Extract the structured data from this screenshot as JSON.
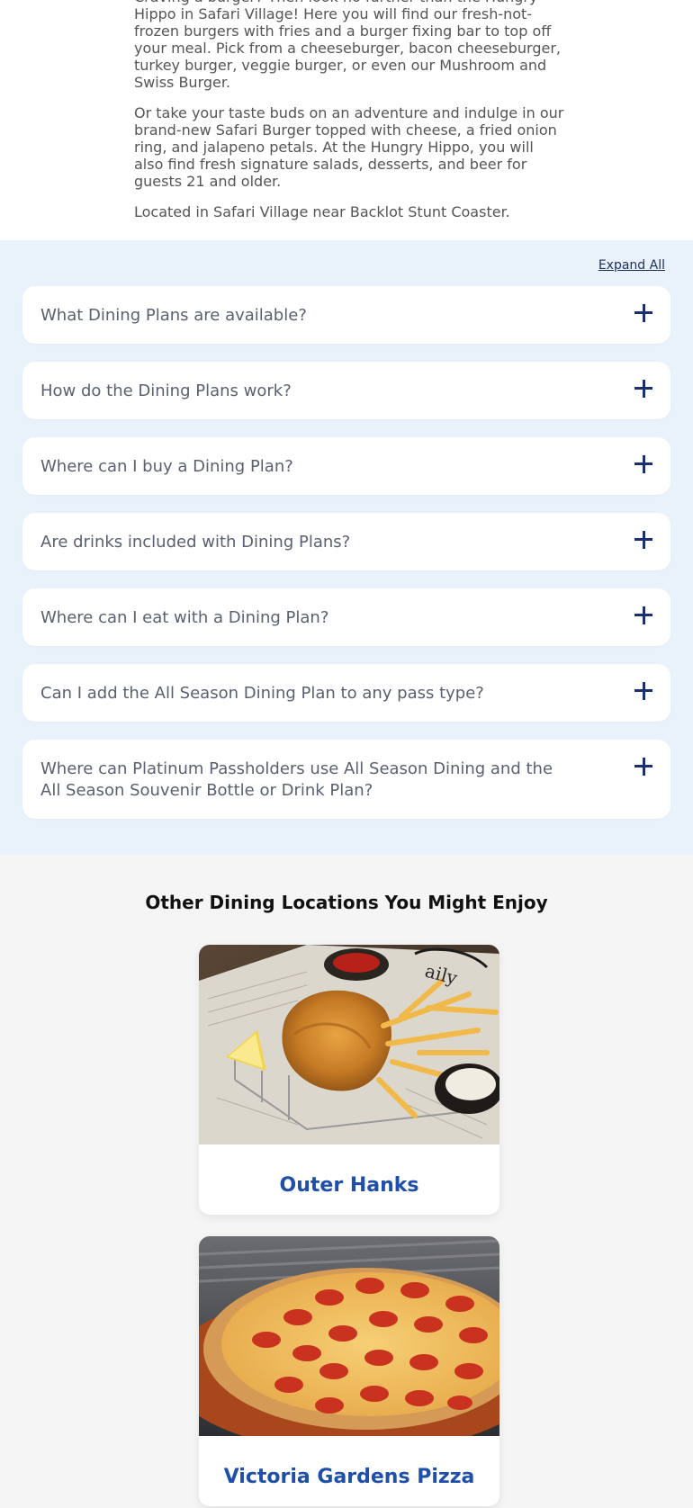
{
  "intro": {
    "paragraphs": [
      "Craving a burger? Then look no further than the Hungry Hippo in Safari Village! Here you will find our fresh-not-frozen burgers with fries and a burger fixing bar to top off your meal. Pick from a cheeseburger, bacon cheeseburger, turkey burger, veggie burger, or even our Mushroom and Swiss Burger.",
      "Or take your taste buds on an adventure and indulge in our brand-new Safari Burger topped with cheese, a fried onion ring, and jalapeno petals. At the Hungry Hippo, you will also find fresh signature salads, desserts, and beer for guests 21 and older.",
      "Located in Safari Village near Backlot Stunt Coaster."
    ]
  },
  "faq": {
    "expand_all_label": "Expand All",
    "items": [
      {
        "question": "What Dining Plans are available?",
        "icon": "plus-icon"
      },
      {
        "question": "How do the Dining Plans work?",
        "icon": "plus-icon"
      },
      {
        "question": "Where can I buy a Dining Plan?",
        "icon": "plus-icon"
      },
      {
        "question": "Are drinks included with Dining Plans?",
        "icon": "plus-icon"
      },
      {
        "question": "Where can I eat with a Dining Plan?",
        "icon": "plus-icon"
      },
      {
        "question": "Can I add the All Season Dining Plan to any pass type?",
        "icon": "plus-icon"
      },
      {
        "question": "Where can Platinum Passholders use All Season Dining and the All Season Souvenir Bottle or Drink Plan?",
        "icon": "plus-icon"
      }
    ]
  },
  "other_dining": {
    "title": "Other Dining Locations You Might Enjoy",
    "cards": [
      {
        "name": "Outer Hanks"
      },
      {
        "name": "Victoria Gardens Pizza"
      }
    ]
  },
  "colors": {
    "faq_bg": "#e9f1fa",
    "icon_navy": "#1a2f73",
    "card_title_blue": "#1f4fa8"
  }
}
